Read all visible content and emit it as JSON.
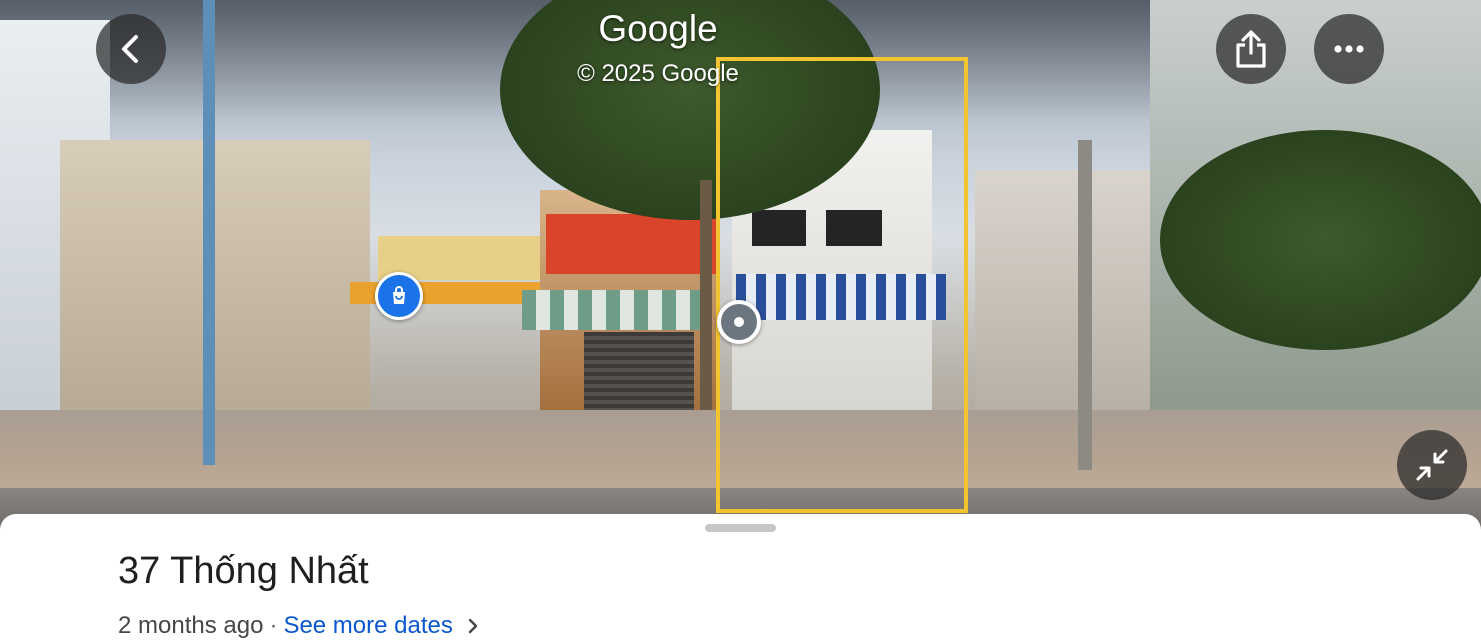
{
  "overlay": {
    "brand": "Google",
    "copyright": "© 2025 Google"
  },
  "place": {
    "address": "37 Thống Nhất",
    "age": "2 months ago",
    "separator": "·",
    "see_more_label": "See more dates"
  },
  "colors": {
    "highlight": "#f2c530",
    "link": "#0b57d0",
    "pin": "#1a73e8"
  },
  "icons": {
    "back": "chevron-left",
    "share": "share-upload",
    "more": "more-horizontal",
    "collapse": "minimize-arrows",
    "shop_pin": "shopping-bag",
    "see_more": "chevron-right"
  }
}
